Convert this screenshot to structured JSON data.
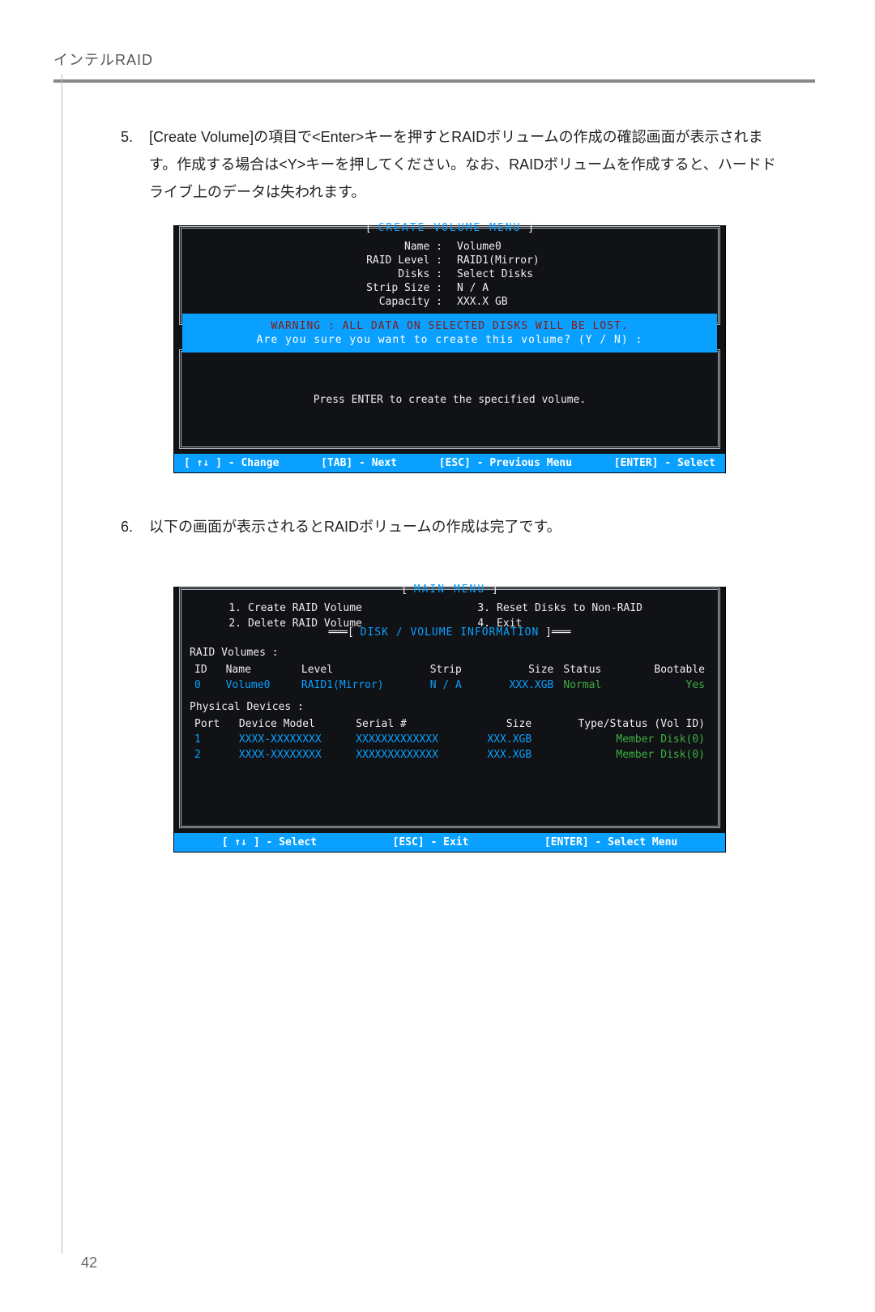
{
  "header": {
    "running": "インテルRAID"
  },
  "steps": {
    "s5": {
      "num": "5.",
      "text": "[Create Volume]の項目で<Enter>キーを押すとRAIDボリュームの作成の確認画面が表示されます。作成する場合は<Y>キーを押してください。なお、RAIDボリュームを作成すると、ハードドライブ上のデータは失われます。"
    },
    "s6": {
      "num": "6.",
      "text": "以下の画面が表示されるとRAIDボリュームの作成は完了です。"
    }
  },
  "bios1": {
    "title": "CREATE VOLUME MENU",
    "fields": {
      "name_k": "Name :",
      "name_v": "Volume0",
      "level_k": "RAID Level :",
      "level_v": "RAID1(Mirror)",
      "disks_k": "Disks :",
      "disks_v": "Select Disks",
      "strip_k": "Strip Size :",
      "strip_v": "N / A",
      "cap_k": "Capacity :",
      "cap_v": "XXX.X GB"
    },
    "warning": "WARNING : ALL DATA ON SELECTED DISKS WILL BE LOST.",
    "prompt": "Are you sure you want to create this volume? (Y / N) :",
    "help": "Press ENTER to create the specified volume.",
    "footer": {
      "a": "[ ↑↓ ] - Change",
      "b": "[TAB] - Next",
      "c": "[ESC] - Previous Menu",
      "d": "[ENTER] - Select"
    }
  },
  "bios2": {
    "title": "MAIN MENU",
    "menu": {
      "n1": "1.",
      "m1": "Create RAID Volume",
      "n2": "2.",
      "m2": "Delete RAID Volume",
      "n3": "3.",
      "m3": "Reset Disks to Non-RAID",
      "n4": "4.",
      "m4": "Exit"
    },
    "info_title": "DISK / VOLUME INFORMATION",
    "raid_label": "RAID Volumes :",
    "raid_head": {
      "id": "ID",
      "name": "Name",
      "level": "Level",
      "strip": "Strip",
      "size": "Size",
      "status": "Status",
      "boot": "Bootable"
    },
    "raid_row": {
      "id": "0",
      "name": "Volume0",
      "level": "RAID1(Mirror)",
      "strip": "N / A",
      "size": "XXX.XGB",
      "status": "Normal",
      "boot": "Yes"
    },
    "phys_label": "Physical Devices :",
    "phys_head": {
      "port": "Port",
      "model": "Device Model",
      "serial": "Serial #",
      "size": "Size",
      "type": "Type/Status (Vol ID)"
    },
    "phys_rows": [
      {
        "port": "1",
        "model": "XXXX-XXXXXXXX",
        "serial": "XXXXXXXXXXXXX",
        "size": "XXX.XGB",
        "type": "Member Disk(0)"
      },
      {
        "port": "2",
        "model": "XXXX-XXXXXXXX",
        "serial": "XXXXXXXXXXXXX",
        "size": "XXX.XGB",
        "type": "Member Disk(0)"
      }
    ],
    "footer": {
      "a": "[ ↑↓ ] - Select",
      "b": "[ESC] - Exit",
      "c": "[ENTER] - Select Menu"
    }
  },
  "pagenum": "42"
}
